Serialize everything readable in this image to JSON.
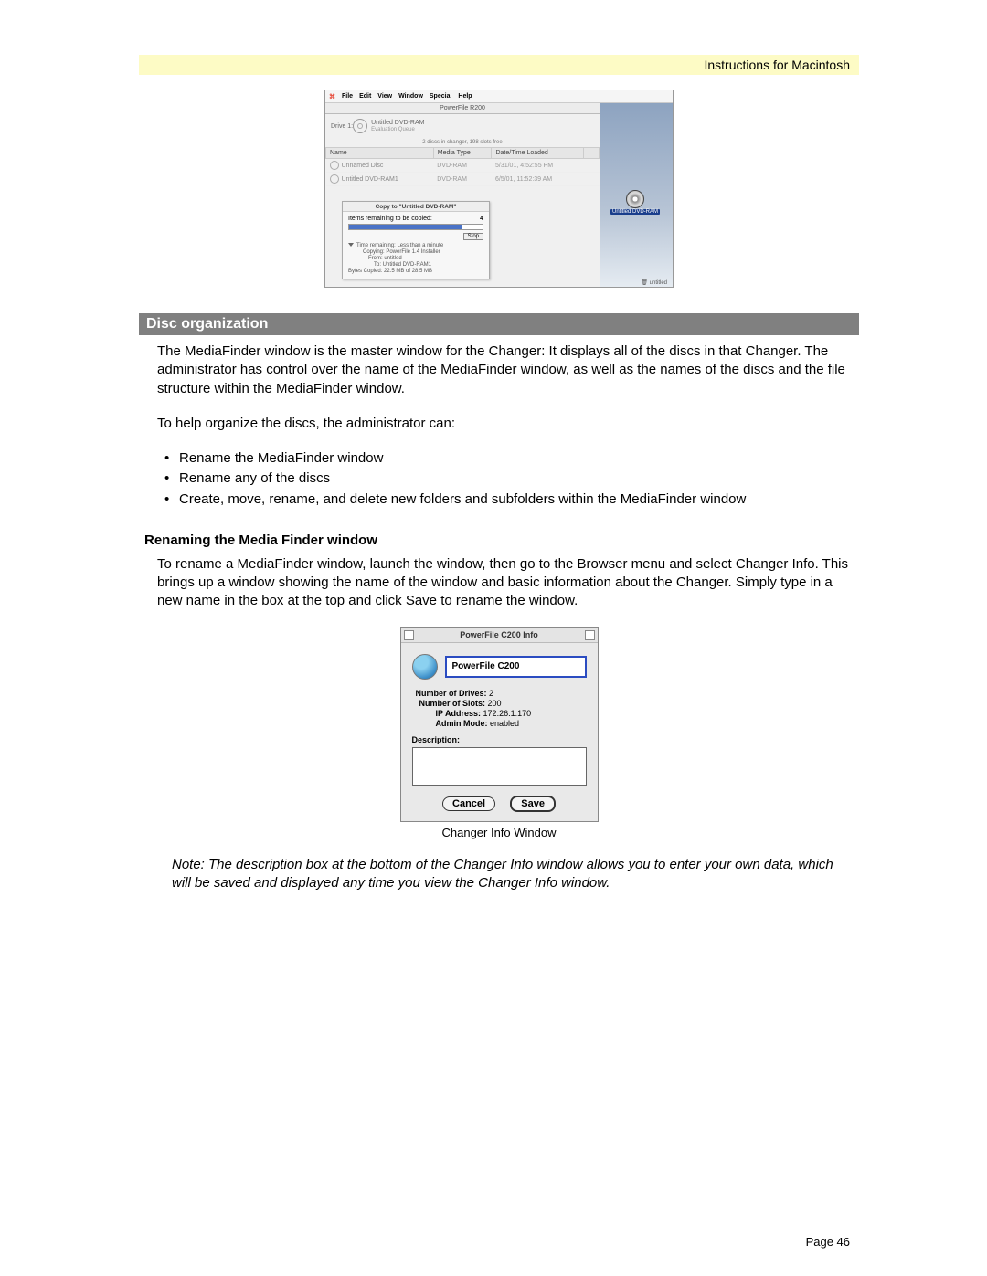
{
  "header": {
    "right_label": "Instructions for Macintosh"
  },
  "screenshot1": {
    "menubar": [
      "File",
      "Edit",
      "View",
      "Window",
      "Special",
      "Help"
    ],
    "window_title": "PowerFile R200",
    "drive_line": {
      "prefix": "Drive 1:",
      "name": "Untitled DVD-RAM",
      "sub": "Evaluation Queue"
    },
    "slot_status": "2 discs in changer, 198 slots free",
    "columns": {
      "name": "Name",
      "media": "Media Type",
      "date": "Date/Time Loaded"
    },
    "rows": [
      {
        "name": "Unnamed Disc",
        "media": "DVD-RAM",
        "date": "5/31/01, 4:52:55 PM"
      },
      {
        "name": "Untitled DVD-RAM1",
        "media": "DVD-RAM",
        "date": "6/5/01, 11:52:39 AM"
      }
    ],
    "copy_dialog": {
      "title": "Copy to \"Untitled DVD-RAM\"",
      "items_label": "Items remaining to be copied:",
      "items_value": "4",
      "stop": "Stop",
      "time_line": "Time remaining:  Less than a minute",
      "copying": "Copying:  PowerFile 1.4 Installer",
      "from": "From:  untitled",
      "to": "To:  Untitled DVD-RAM1",
      "bytes": "Bytes Copied:  22.5 MB of 28.5 MB"
    },
    "desktop_icon_label": "Untitled DVD-RAM",
    "trash_label": "untitled"
  },
  "section": {
    "title": "Disc organization",
    "para1": "The MediaFinder window is the master window for the Changer: It displays all of the discs in that Changer. The administrator has control over the name of the MediaFinder window, as well as the names of the discs and the file structure within the MediaFinder window.",
    "para2": "To help organize the discs, the administrator can:",
    "bullets": [
      "Rename the MediaFinder window",
      "Rename any of the discs",
      "Create, move, rename, and delete new folders and subfolders within the MediaFinder window"
    ]
  },
  "subsection": {
    "title": "Renaming the Media Finder window",
    "para": "To rename a MediaFinder window, launch the window, then go to the Browser menu and select Changer Info. This brings up a window showing the name of the window and basic information about the Changer. Simply type in a new name in the box at the top and click Save to rename the window."
  },
  "changer_info": {
    "title": "PowerFile C200 Info",
    "name_value": "PowerFile C200",
    "fields": {
      "drives_label": "Number of Drives:",
      "drives_value": "2",
      "slots_label": "Number of Slots:",
      "slots_value": "200",
      "ip_label": "IP Address:",
      "ip_value": "172.26.1.170",
      "admin_label": "Admin Mode:",
      "admin_value": "enabled"
    },
    "description_label": "Description:",
    "cancel": "Cancel",
    "save": "Save",
    "caption": "Changer Info Window"
  },
  "note": "Note: The description box at the bottom of the Changer Info window allows you to enter your own data, which will be saved and displayed any time you view the Changer Info window.",
  "footer": {
    "page_label": "Page 46"
  }
}
